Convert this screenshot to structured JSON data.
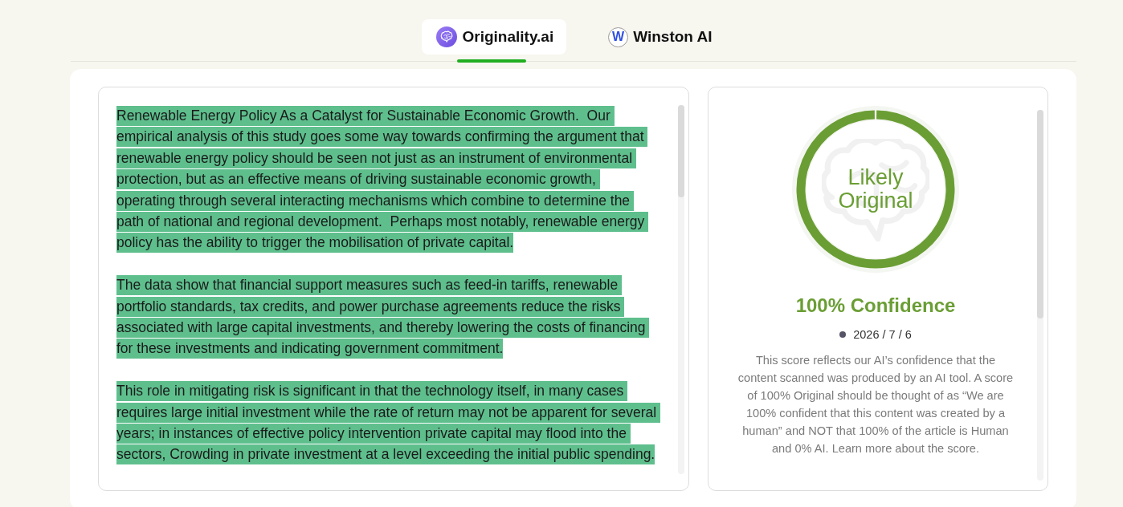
{
  "tabs": [
    {
      "kind": "brain-logo",
      "label": "Originality.ai",
      "selected": true
    },
    {
      "kind": "letter-logo",
      "logo_letter": "W",
      "label": "Winston AI",
      "selected": false
    }
  ],
  "document": {
    "paragraphs": [
      {
        "text": "Renewable Energy Policy As a Catalyst for Sustainable Economic Growth.  Our empirical analysis of this study goes some way towards confirming the argument that renewable energy policy should be seen not just as an instrument of environmental protection, but as an effective means of driving sustainable economic growth, operating through several interacting mechanisms which combine to determine the path of national and regional development.  Perhaps most notably, renewable energy policy has the ability to trigger the mobilisation of private capital.",
        "highlighted": true
      },
      {
        "text": "The data show that financial support measures such as feed-in tariffs, renewable portfolio standards, tax credits, and power purchase agreements reduce the risks associated with large capital investments, and thereby lowering the costs of financing for these investments and indicating government commitment.",
        "highlighted": true
      },
      {
        "text": "This role in mitigating risk is significant in that the technology itself, in many cases requires large initial investment while the rate of return may not be apparent for several years; in instances of effective policy intervention private capital may flood into the sectors, Crowding in private investment at a level exceeding the initial public spending.",
        "highlighted": true
      }
    ]
  },
  "result": {
    "verdict": "Likely Original",
    "level": 1,
    "confidence": "100% Confidence",
    "date": "2026 / 7 / 6",
    "description": "This score reflects our AI’s confidence that the content scanned was produced by an AI tool. A score of 100% Original should be thought of as “We are 100% confident that this content was created by a human” and NOT that 100% of the article is Human and 0% AI. Learn more about the score."
  }
}
